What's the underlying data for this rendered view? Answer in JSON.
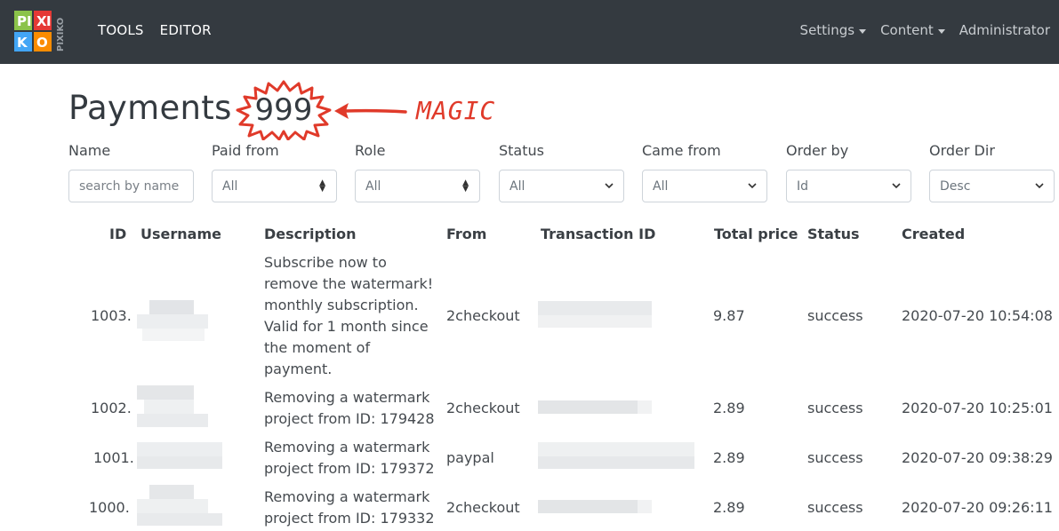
{
  "nav": {
    "logo_letters": [
      "PI",
      "XI",
      "KO"
    ],
    "logo_side_text": "PIXIKO",
    "left_items": [
      "TOOLS",
      "EDITOR"
    ],
    "right_items": [
      "Settings",
      "Content",
      "Administrator"
    ]
  },
  "page": {
    "title": "Payments",
    "count": "999",
    "annotation": "MAGIC"
  },
  "colors": {
    "navbar_bg": "#343a40",
    "annotation_red": "#e03a2a"
  },
  "filters": [
    {
      "label": "Name",
      "type": "input",
      "placeholder": "search by name",
      "value": ""
    },
    {
      "label": "Paid from",
      "type": "select",
      "value": "All"
    },
    {
      "label": "Role",
      "type": "select",
      "value": "All"
    },
    {
      "label": "Status",
      "type": "select",
      "value": "All"
    },
    {
      "label": "Came from",
      "type": "select",
      "value": "All"
    },
    {
      "label": "Order by",
      "type": "select",
      "value": "Id"
    },
    {
      "label": "Order Dir",
      "type": "select",
      "value": "Desc"
    }
  ],
  "table": {
    "headers": [
      "ID",
      "Username",
      "Description",
      "From",
      "Transaction ID",
      "Total price",
      "Status",
      "Created"
    ],
    "rows": [
      {
        "id": "1003.",
        "description": [
          "Subscribe now to",
          "remove the watermark!",
          "monthly subscription.",
          "Valid for 1 month since",
          "the moment of",
          "payment."
        ],
        "from": "2checkout",
        "total": "9.87",
        "status": "success",
        "created": "2020-07-20 10:54:08"
      },
      {
        "id": "1002.",
        "description": [
          "Removing a watermark",
          "project from ID: 179428"
        ],
        "from": "2checkout",
        "total": "2.89",
        "status": "success",
        "created": "2020-07-20 10:25:01"
      },
      {
        "id": "1001.",
        "description": [
          "Removing a watermark",
          "project from ID: 179372"
        ],
        "from": "paypal",
        "total": "2.89",
        "status": "success",
        "created": "2020-07-20 09:38:29"
      },
      {
        "id": "1000.",
        "description": [
          "Removing a watermark",
          "project from ID: 179332"
        ],
        "from": "2checkout",
        "total": "2.89",
        "status": "success",
        "created": "2020-07-20 09:26:11"
      }
    ]
  }
}
